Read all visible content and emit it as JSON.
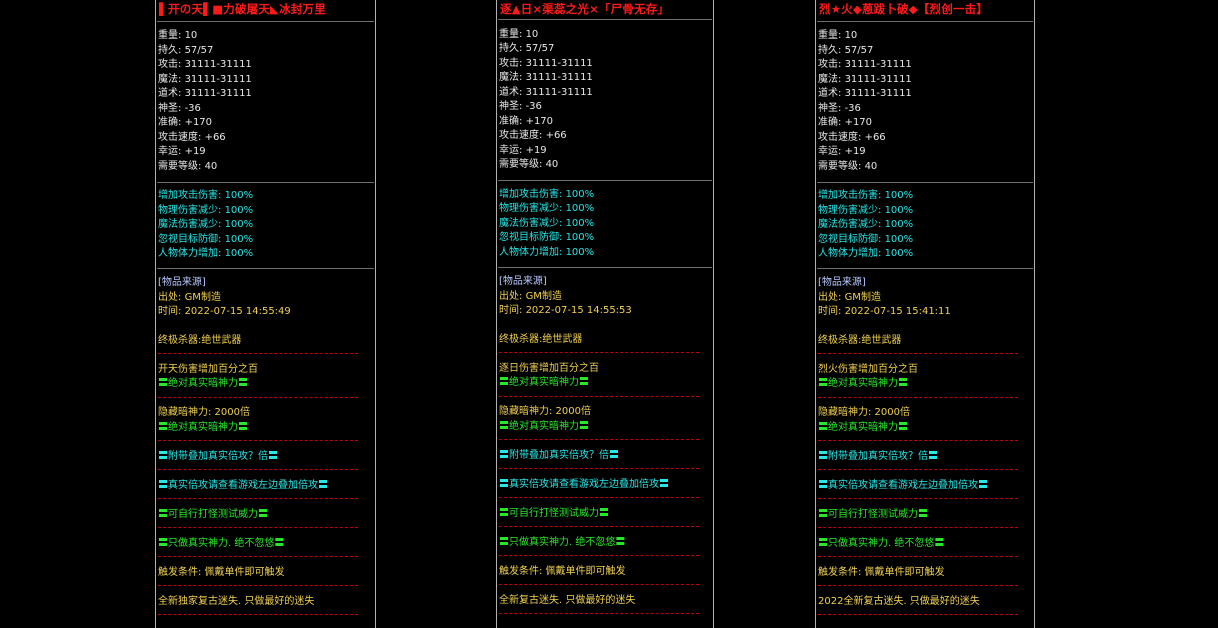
{
  "colors": {
    "title": "#ff1a1a",
    "stat": "#e8e8e8",
    "bonus": "#27e6e6",
    "yellow": "#f0d050",
    "green": "#28e628",
    "source_header": "#b8c8ff",
    "divider": "#c00000"
  },
  "panels": [
    {
      "title": "▌开の天▌■力破屠天◣冰封万里",
      "stats": [
        {
          "label": "重量:",
          "value": "10"
        },
        {
          "label": "持久:",
          "value": "57/57"
        },
        {
          "label": "攻击:",
          "value": "31111-31111"
        },
        {
          "label": "魔法:",
          "value": "31111-31111"
        },
        {
          "label": "道术:",
          "value": "31111-31111"
        },
        {
          "label": "神圣:",
          "value": "-36"
        },
        {
          "label": "准确:",
          "value": "+170"
        },
        {
          "label": "攻击速度:",
          "value": "+66"
        },
        {
          "label": "幸运:",
          "value": "+19"
        },
        {
          "label": "需要等级:",
          "value": "40"
        }
      ],
      "bonuses": [
        {
          "label": "增加攻击伤害:",
          "value": "100%"
        },
        {
          "label": "物理伤害减少:",
          "value": "100%"
        },
        {
          "label": "魔法伤害减少:",
          "value": "100%"
        },
        {
          "label": "忽视目标防御:",
          "value": "100%"
        },
        {
          "label": "人物体力增加:",
          "value": "100%"
        }
      ],
      "source": {
        "header": "[物品来源]",
        "origin_label": "出处:",
        "origin_value": "GM制造",
        "time_label": "时间:",
        "time_value": "2022-07-15 14:55:49"
      },
      "desc": [
        "终极杀器:绝世武器",
        "开天伤害增加百分之百",
        "〓绝对真实暗神力〓",
        "隐藏暗神力: 2000倍",
        "〓绝对真实暗神力〓",
        "〓附带叠加真实倍攻？倍〓",
        "〓真实倍攻请查看游戏左边叠加倍攻〓",
        "〓可自行打怪测试威力〓",
        "〓只做真实神力. 绝不忽悠〓",
        "触发条件: 佩戴单件即可触发",
        "全新独家复古迷失. 只做最好的迷失"
      ]
    },
    {
      "title": "逐▲日×渠蕊之光×「尸骨无存」",
      "stats": [
        {
          "label": "重量:",
          "value": "10"
        },
        {
          "label": "持久:",
          "value": "57/57"
        },
        {
          "label": "攻击:",
          "value": "31111-31111"
        },
        {
          "label": "魔法:",
          "value": "31111-31111"
        },
        {
          "label": "道术:",
          "value": "31111-31111"
        },
        {
          "label": "神圣:",
          "value": "-36"
        },
        {
          "label": "准确:",
          "value": "+170"
        },
        {
          "label": "攻击速度:",
          "value": "+66"
        },
        {
          "label": "幸运:",
          "value": "+19"
        },
        {
          "label": "需要等级:",
          "value": "40"
        }
      ],
      "bonuses": [
        {
          "label": "增加攻击伤害:",
          "value": "100%"
        },
        {
          "label": "物理伤害减少:",
          "value": "100%"
        },
        {
          "label": "魔法伤害减少:",
          "value": "100%"
        },
        {
          "label": "忽视目标防御:",
          "value": "100%"
        },
        {
          "label": "人物体力增加:",
          "value": "100%"
        }
      ],
      "source": {
        "header": "[物品来源]",
        "origin_label": "出处:",
        "origin_value": "GM制造",
        "time_label": "时间:",
        "time_value": "2022-07-15 14:55:53"
      },
      "desc": [
        "终极杀器:绝世武器",
        "逐日伤害增加百分之百",
        "〓绝对真实暗神力〓",
        "隐藏暗神力: 2000倍",
        "〓绝对真实暗神力〓",
        "〓附带叠加真实倍攻？倍〓",
        "〓真实倍攻请查看游戏左边叠加倍攻〓",
        "〓可自行打怪测试威力〓",
        "〓只做真实神力. 绝不忽悠〓",
        "触发条件: 佩戴单件即可触发",
        "全新复古迷失. 只做最好的迷失"
      ]
    },
    {
      "title": "烈★火◆蒽跋卜破◆【烈创一击】",
      "stats": [
        {
          "label": "重量:",
          "value": "10"
        },
        {
          "label": "持久:",
          "value": "57/57"
        },
        {
          "label": "攻击:",
          "value": "31111-31111"
        },
        {
          "label": "魔法:",
          "value": "31111-31111"
        },
        {
          "label": "道术:",
          "value": "31111-31111"
        },
        {
          "label": "神圣:",
          "value": "-36"
        },
        {
          "label": "准确:",
          "value": "+170"
        },
        {
          "label": "攻击速度:",
          "value": "+66"
        },
        {
          "label": "幸运:",
          "value": "+19"
        },
        {
          "label": "需要等级:",
          "value": "40"
        }
      ],
      "bonuses": [
        {
          "label": "增加攻击伤害:",
          "value": "100%"
        },
        {
          "label": "物理伤害减少:",
          "value": "100%"
        },
        {
          "label": "魔法伤害减少:",
          "value": "100%"
        },
        {
          "label": "忽视目标防御:",
          "value": "100%"
        },
        {
          "label": "人物体力增加:",
          "value": "100%"
        }
      ],
      "source": {
        "header": "[物品来源]",
        "origin_label": "出处:",
        "origin_value": "GM制造",
        "time_label": "时间:",
        "time_value": "2022-07-15 15:41:11"
      },
      "desc": [
        "终极杀器:绝世武器",
        "烈火伤害增加百分之百",
        "〓绝对真实暗神力〓",
        "隐藏暗神力: 2000倍",
        "〓绝对真实暗神力〓",
        "〓附带叠加真实倍攻？倍〓",
        "〓真实倍攻请查看游戏左边叠加倍攻〓",
        "〓可自行打怪测试威力〓",
        "〓只做真实神力. 绝不忽悠〓",
        "触发条件: 佩戴单件即可触发",
        "2022全新复古迷失. 只做最好的迷失"
      ]
    }
  ]
}
